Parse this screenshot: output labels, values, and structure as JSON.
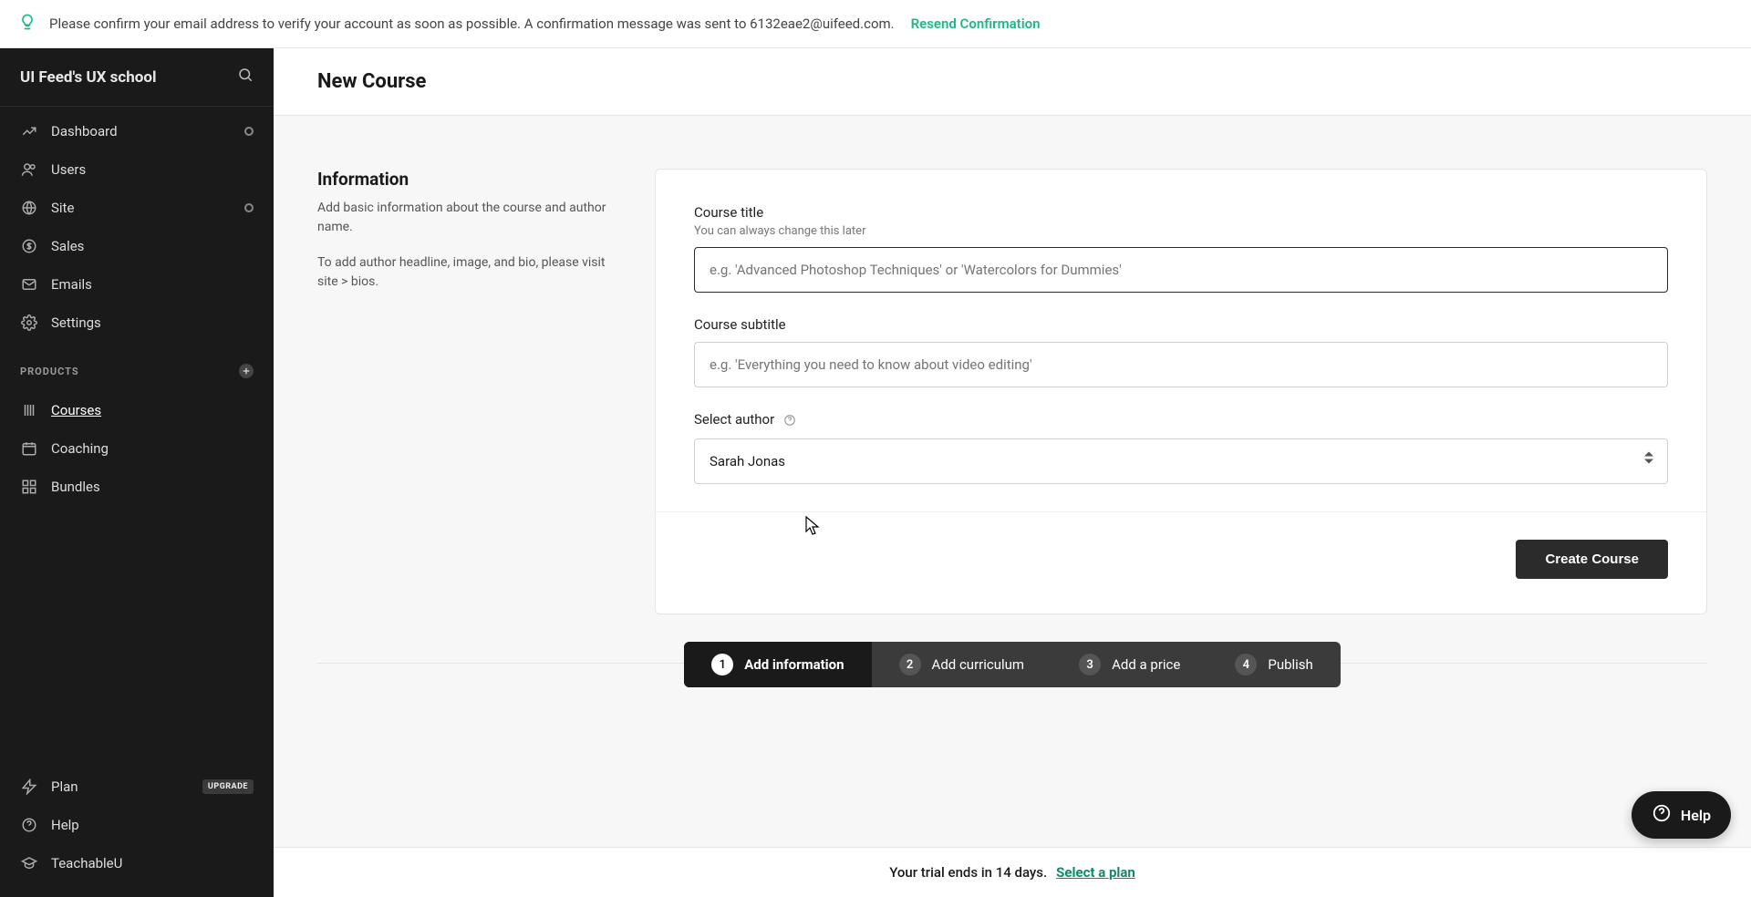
{
  "banner": {
    "text": "Please confirm your email address to verify your account as soon as possible. A confirmation message was sent to 6132eae2@uifeed.com.",
    "resend_label": "Resend Confirmation"
  },
  "sidebar": {
    "school_name": "UI Feed's UX school",
    "items": [
      {
        "label": "Dashboard",
        "icon": "trend",
        "trailing": "circle"
      },
      {
        "label": "Users",
        "icon": "users"
      },
      {
        "label": "Site",
        "icon": "globe",
        "trailing": "circle"
      },
      {
        "label": "Sales",
        "icon": "dollar"
      },
      {
        "label": "Emails",
        "icon": "mail"
      },
      {
        "label": "Settings",
        "icon": "gear"
      }
    ],
    "products_label": "PRODUCTS",
    "product_items": [
      {
        "label": "Courses",
        "icon": "book",
        "active": true
      },
      {
        "label": "Coaching",
        "icon": "calendar"
      },
      {
        "label": "Bundles",
        "icon": "grid"
      }
    ],
    "bottom_items": [
      {
        "label": "Plan",
        "icon": "bolt",
        "badge": "UPGRADE"
      },
      {
        "label": "Help",
        "icon": "help"
      },
      {
        "label": "TeachableU",
        "icon": "gradcap"
      }
    ]
  },
  "page": {
    "title": "New Course"
  },
  "section": {
    "heading": "Information",
    "desc1": "Add basic information about the course and author name.",
    "desc2": "To add author headline, image, and bio, please visit site > bios."
  },
  "form": {
    "course_title_label": "Course title",
    "course_title_hint": "You can always change this later",
    "course_title_placeholder": "e.g. 'Advanced Photoshop Techniques' or 'Watercolors for Dummies'",
    "course_subtitle_label": "Course subtitle",
    "course_subtitle_placeholder": "e.g. 'Everything you need to know about video editing'",
    "select_author_label": "Select author",
    "author_value": "Sarah Jonas",
    "create_button": "Create Course"
  },
  "steps": [
    {
      "num": "1",
      "label": "Add information",
      "active": true
    },
    {
      "num": "2",
      "label": "Add curriculum"
    },
    {
      "num": "3",
      "label": "Add a price"
    },
    {
      "num": "4",
      "label": "Publish"
    }
  ],
  "trial": {
    "text": "Your trial ends in 14 days.",
    "link": "Select a plan"
  },
  "help_fab": "Help"
}
